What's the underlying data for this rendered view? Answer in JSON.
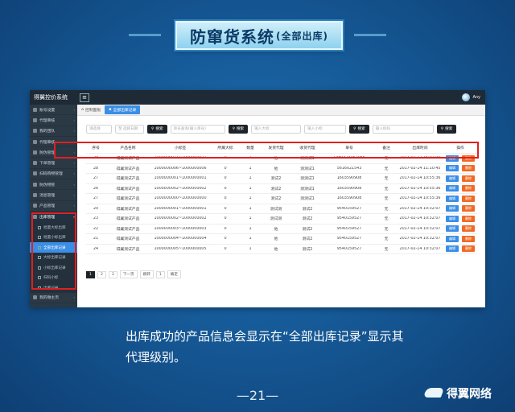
{
  "banner": {
    "title": "防窜货系统",
    "subtitle": "(全部出库)"
  },
  "app": {
    "brand": "得翼控价系统",
    "menu_icon": "hamburger-icon",
    "user": "Any",
    "tabs": [
      {
        "label": "控制面板"
      },
      {
        "label": "全部出库记录",
        "active": true
      }
    ],
    "sidebar": [
      {
        "label": "账号设置"
      },
      {
        "label": "代理审核"
      },
      {
        "label": "我的团队"
      },
      {
        "label": "代理审核"
      },
      {
        "label": "防伪管理"
      },
      {
        "label": "下单管理"
      },
      {
        "label": "扫码购物管理"
      },
      {
        "label": "防伪物管"
      },
      {
        "label": "消息管理"
      },
      {
        "label": "产品管理"
      },
      {
        "label": "出库管理",
        "open": true
      }
    ],
    "sidebar_sub": [
      {
        "label": "批量大标出库"
      },
      {
        "label": "批量小标出库"
      },
      {
        "label": "全部出库记录",
        "active": true
      },
      {
        "label": "大标出库记录"
      },
      {
        "label": "小标出库记录"
      },
      {
        "label": "扫码小标"
      },
      {
        "label": "出库记录"
      }
    ],
    "sidebar_last": {
      "label": "我的微主页"
    },
    "filters": [
      {
        "placeholder": "请选择",
        "width": 32
      },
      {
        "placeholder": "至 选择日期",
        "width": 36
      },
      {
        "button": "搜索"
      },
      {
        "placeholder": "单号查询(输入单号)",
        "width": 68
      },
      {
        "button": "搜索"
      },
      {
        "placeholder": "输入大标",
        "width": 62
      },
      {
        "placeholder": "输入小标",
        "width": 52
      },
      {
        "button": "搜索"
      },
      {
        "placeholder": "输入标码",
        "width": 76
      },
      {
        "button": "搜索"
      }
    ],
    "table": {
      "headers": [
        "序号",
        "产品名称",
        "小标签",
        "所属大标",
        "数量",
        "发货代理",
        "收货代理",
        "单号",
        "备注",
        "出库时间",
        "操作"
      ],
      "edit_label": "编辑",
      "delete_label": "删除",
      "rows": [
        [
          "29",
          "得翼测试产品",
          "1000000021~1000000021",
          "0",
          "1",
          "他",
          "测测试1",
          "1480323362065",
          "无",
          "2017-02-17 16:07:00"
        ],
        [
          "28",
          "得翼测试产品",
          "1000000006~1000000006",
          "0",
          "1",
          "他",
          "测测试1",
          "5616021543",
          "无",
          "2017-02-14 11:10:45"
        ],
        [
          "27",
          "得翼测试产品",
          "1000000001~1000000001",
          "0",
          "1",
          "测试2",
          "测测试1",
          "1603590908",
          "无",
          "2017-02-14 10:55:36"
        ],
        [
          "26",
          "得翼测试产品",
          "1000000002~1000000002",
          "0",
          "1",
          "测试2",
          "测测试1",
          "1603590908",
          "无",
          "2017-02-14 10:55:36"
        ],
        [
          "27",
          "得翼测试产品",
          "1000000000~1000000000",
          "0",
          "1",
          "测试2",
          "测测试1",
          "1603590908",
          "无",
          "2017-02-14 10:55:36"
        ],
        [
          "20",
          "得翼测试产品",
          "1000000001~1000000001",
          "0",
          "1",
          "测试测",
          "测试2",
          "9540159527",
          "无",
          "2017-02-14 10:32:07"
        ],
        [
          "23",
          "得翼测试产品",
          "1000000002~1000000002",
          "0",
          "1",
          "测试测",
          "测试2",
          "9540159527",
          "无",
          "2017-02-14 10:32:07"
        ],
        [
          "22",
          "得翼测试产品",
          "1000000003~1000000003",
          "0",
          "1",
          "他",
          "测试2",
          "9540159527",
          "无",
          "2017-02-14 10:32:07"
        ],
        [
          "21",
          "得翼测试产品",
          "1000000004~1000000004",
          "0",
          "1",
          "他",
          "测试2",
          "9540159527",
          "无",
          "2017-02-14 10:32:07"
        ],
        [
          "24",
          "得翼测试产品",
          "1000000005~1000000005",
          "0",
          "1",
          "他",
          "测试2",
          "9540159527",
          "无",
          "2017-02-14 10:32:07"
        ]
      ]
    },
    "pager": [
      "1",
      "2",
      "3",
      "下一页",
      "跳转",
      "1",
      "确定"
    ]
  },
  "caption": "出库成功的产品信息会显示在“全部出库记录”显示其代理级别。",
  "page_number": "—21—",
  "logo_text": "得翼网络",
  "highlight_color": "#e02020",
  "accent_color": "#3a8ee6"
}
